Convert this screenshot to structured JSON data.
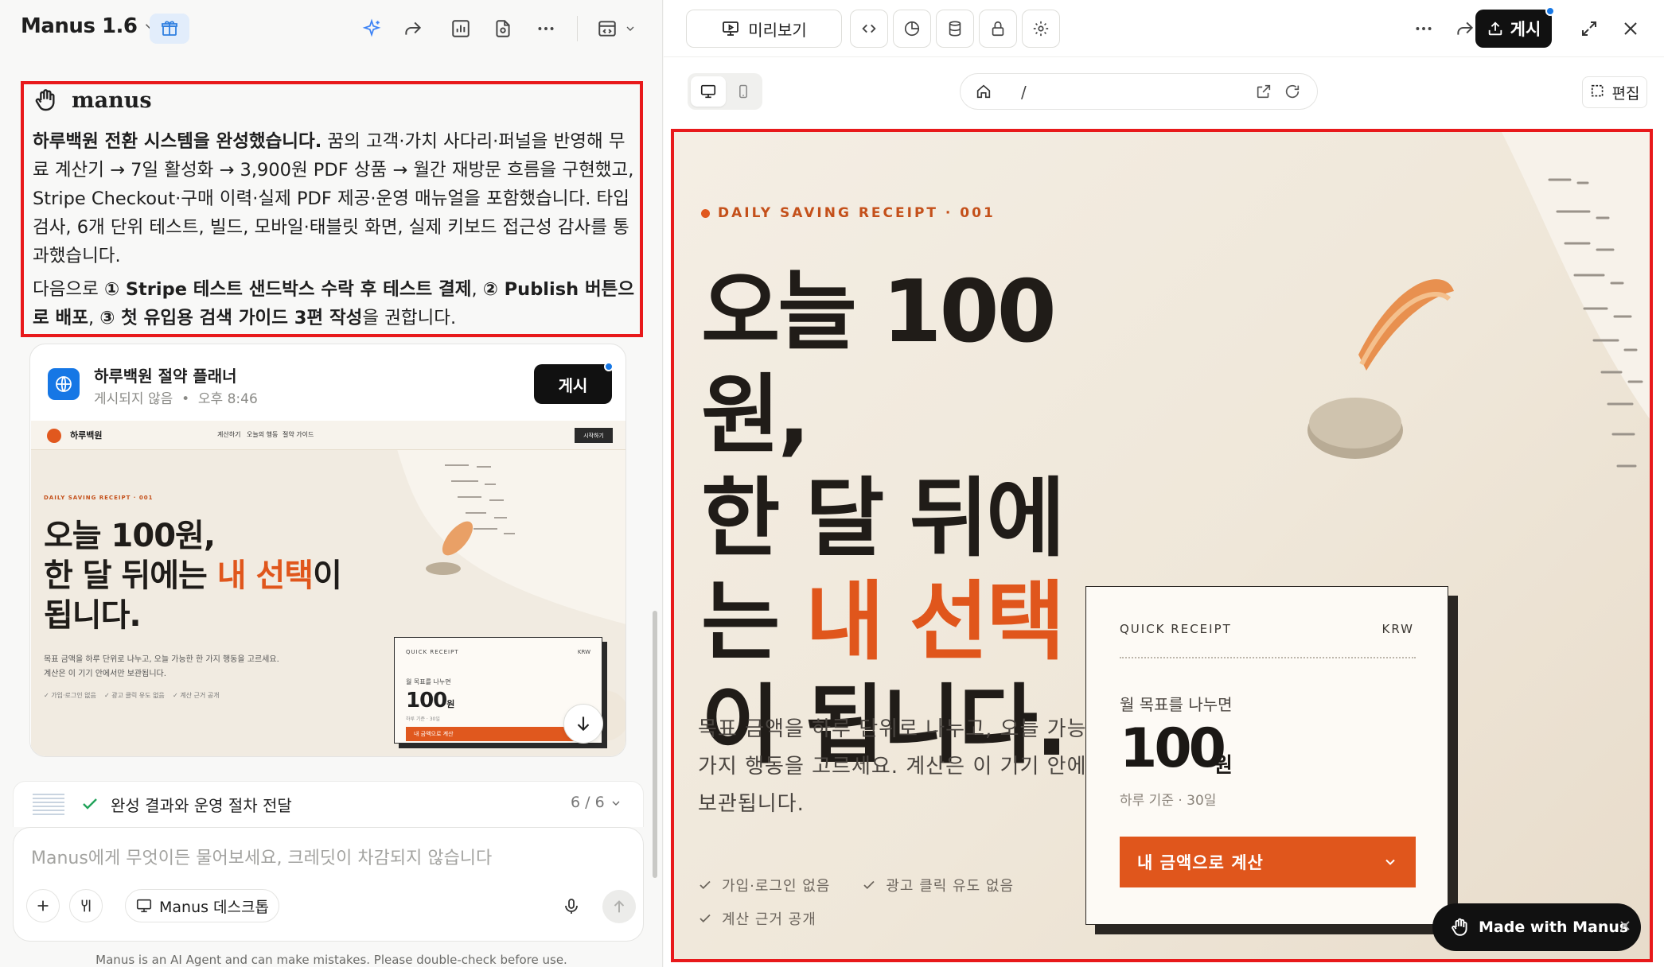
{
  "left_header": {
    "title": "Manus 1.6"
  },
  "message": {
    "brand": "manus",
    "p1_bold": "하루백원 전환 시스템을 완성했습니다.",
    "p1_rest": " 꿈의 고객·가치 사다리·퍼널을 반영해 무료 계산기 → 7일 활성화 → 3,900원 PDF 상품 → 월간 재방문 흐름을 구현했고, Stripe Checkout·구매 이력·실제 PDF 제공·운영 매뉴얼을 포함했습니다. 타입 검사, 6개 단위 테스트, 빌드, 모바일·태블릿 화면, 실제 키보드 접근성 감사를 통과했습니다.",
    "p2_a": "다음으로 ",
    "p2_b1": "① Stripe 테스트 샌드박스 수락 후 테스트 결제",
    "p2_c": ", ",
    "p2_b2": "② Publish 버튼으로 배포",
    "p2_d": ", ",
    "p2_b3": "③ 첫 유입용 검색 가이드 3편 작성",
    "p2_e": "을 권합니다."
  },
  "site_card": {
    "title": "하루백원 절약 플래너",
    "status": "게시되지 않음",
    "sep": "•",
    "time": "오후 8:46",
    "publish": "게시",
    "thumb": {
      "brand": "하루백원",
      "nav": [
        "계산하기",
        "오늘의 행동",
        "절약 가이드"
      ],
      "nav_btn": "시작하기",
      "eyebrow": "DAILY SAVING RECEIPT · 001",
      "h1": "오늘 100원,",
      "h2a": "한 달 뒤에는 ",
      "h2b": "내 선택",
      "h2c": "이",
      "h3": "됩니다.",
      "desc1": "목표 금액을 하루 단위로 나누고, 오늘 가능한 한 가지 행동을 고르세요.",
      "desc2": "계산은 이 기기 안에서만 보관됩니다.",
      "checks": [
        "가입·로그인 없음",
        "광고 클릭 유도 없음",
        "계산 근거 공개"
      ],
      "r_label": "QUICK RECEIPT",
      "r_cur": "KRW",
      "r_month": "월 목표를 나누면",
      "r_amount": "100",
      "r_unit": "원",
      "r_daily": "하루 기준 · 30일",
      "r_btn": "내 금액으로 계산"
    }
  },
  "task": {
    "label": "완성 결과와 운영 절차 전달",
    "count": "6 / 6"
  },
  "composer": {
    "placeholder": "Manus에게 무엇이든 물어보세요, 크레딧이 차감되지 않습니다",
    "desktop": "Manus 데스크톱"
  },
  "disclaimer": "Manus is an AI Agent and can make mistakes. Please double-check before use.",
  "right_header": {
    "preview": "미리보기",
    "publish": "게시",
    "edit": "편집",
    "url": "/"
  },
  "website": {
    "eyebrow": "DAILY SAVING RECEIPT · 001",
    "l1": "오늘 100원,",
    "l2": "한 달 뒤에",
    "l3a": "는 ",
    "l3b": "내 선택",
    "l4": "이 됩니다.",
    "desc": "목표 금액을 하루 단위로 나누고, 오늘 가능한 한 가지 행동을 고르세요. 계산은 이 기기 안에서만 보관됩니다.",
    "checks": [
      "가입·로그인 없음",
      "광고 클릭 유도 없음",
      "계산 근거 공개"
    ],
    "receipt": {
      "label": "QUICK RECEIPT",
      "currency": "KRW",
      "month": "월 목표를 나누면",
      "amount": "100",
      "unit": "원",
      "daily": "하루 기준 · 30일",
      "button": "내 금액으로 계산"
    }
  },
  "made_with": "Made with Manus",
  "colors": {
    "accent": "#e0561c",
    "highlight_border": "#e8191b",
    "primary_dark": "#111111",
    "link_blue": "#1677e5"
  },
  "icons": [
    "chevron-down-icon",
    "gift-icon",
    "sparkle-icon",
    "share-icon",
    "chart-icon",
    "file-icon",
    "more-icon",
    "code-panel-icon",
    "monitor-icon",
    "code-icon",
    "pie-icon",
    "database-icon",
    "lock-icon",
    "gear-icon",
    "expand-icon",
    "close-icon",
    "home-icon",
    "external-icon",
    "refresh-icon",
    "select-edit-icon",
    "globe-icon",
    "arrow-down-icon",
    "check-icon",
    "plus-icon",
    "connector-icon",
    "mic-icon",
    "arrow-up-icon",
    "hand-logo-icon",
    "phone-icon"
  ]
}
